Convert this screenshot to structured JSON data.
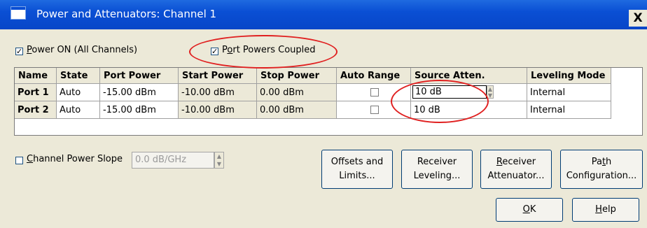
{
  "window": {
    "title": "Power and Attenuators: Channel 1",
    "close_glyph": "X"
  },
  "power_on": {
    "checked": true,
    "label_pre": "",
    "label_accel": "P",
    "label_post": "ower ON (All Channels)"
  },
  "port_powers_coupled": {
    "checked": true,
    "label_pre": "P",
    "label_accel": "o",
    "label_post": "rt Powers Coupled"
  },
  "table": {
    "columns": [
      "Name",
      "State",
      "Port Power",
      "Start Power",
      "Stop Power",
      "Auto Range",
      "Source Atten.",
      "Leveling Mode"
    ],
    "rows": [
      {
        "name": "Port 1",
        "state": "Auto",
        "port_power": "-15.00 dBm",
        "start_power": "-10.00 dBm",
        "stop_power": "0.00 dBm",
        "auto_range": false,
        "source_atten": "10 dB",
        "leveling_mode": "Internal"
      },
      {
        "name": "Port 2",
        "state": "Auto",
        "port_power": "-15.00 dBm",
        "start_power": "-10.00 dBm",
        "stop_power": "0.00 dBm",
        "auto_range": false,
        "source_atten": "10 dB",
        "leveling_mode": "Internal"
      }
    ]
  },
  "channel_power_slope": {
    "checked": false,
    "label_pre": "",
    "label_accel": "C",
    "label_post": "hannel Power Slope",
    "value": "0.0 dB/GHz"
  },
  "buttons": {
    "offsets": {
      "line1": "Offsets and",
      "line2": "Limits..."
    },
    "receiver_leveling": {
      "line1": "Receiver",
      "line2": "Leveling..."
    },
    "receiver_attenuator": {
      "line1_accel": "R",
      "line1_rest": "eceiver",
      "line2": "Attenuator..."
    },
    "path_configuration": {
      "line1_pre": "Pa",
      "line1_accel": "t",
      "line1_post": "h",
      "line2": "Configuration..."
    },
    "ok": {
      "accel": "O",
      "rest": "K"
    },
    "help": {
      "accel": "H",
      "rest": "elp"
    }
  },
  "colors": {
    "title_bar": "#0a4fd4",
    "dialog_bg": "#ece9d8",
    "annotation": "#e02020"
  }
}
